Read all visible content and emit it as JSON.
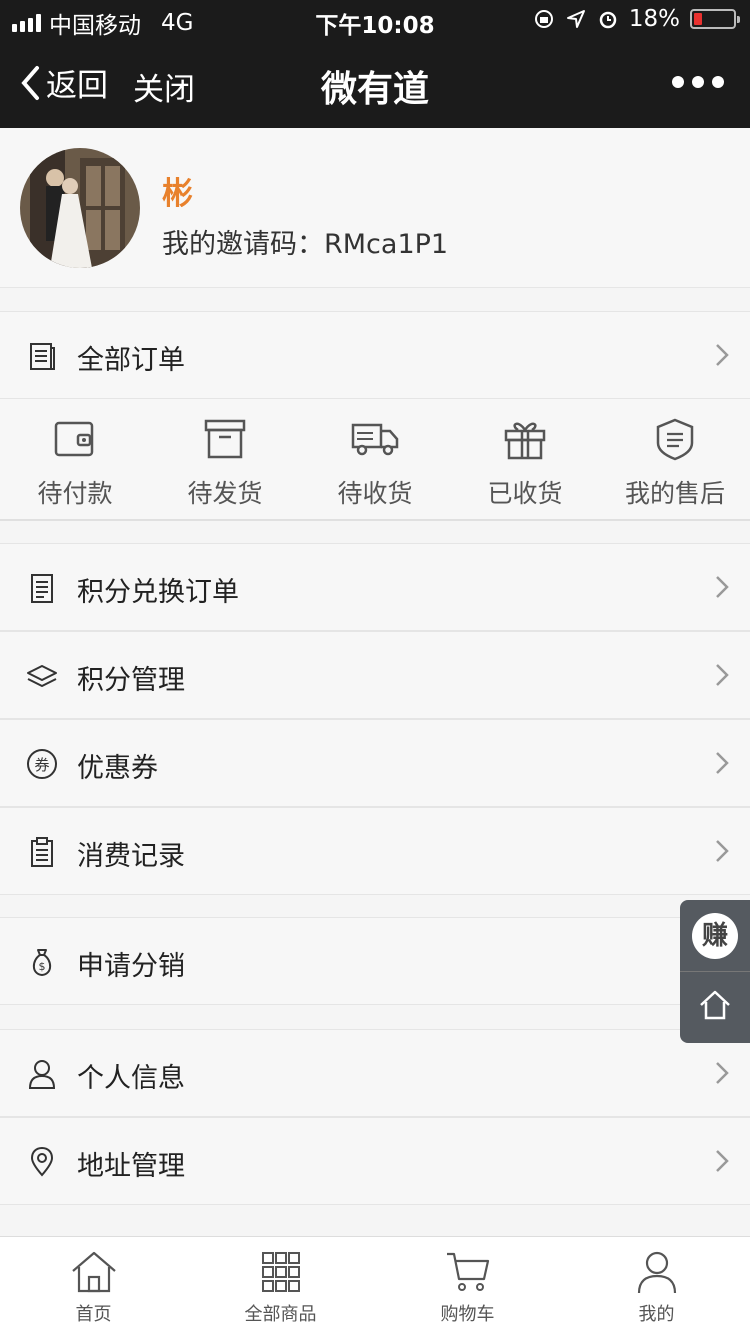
{
  "status_bar": {
    "carrier": "中国移动",
    "network": "4G",
    "time": "下午10:08",
    "battery": "18%"
  },
  "nav": {
    "back_label": "返回",
    "close_label": "关闭",
    "title": "微有道"
  },
  "profile": {
    "name": "彬",
    "invite_code": "我的邀请码：RMca1P1"
  },
  "orders": {
    "all_label": "全部订单",
    "statuses": [
      {
        "label": "待付款",
        "icon": "wallet-icon"
      },
      {
        "label": "待发货",
        "icon": "box-icon"
      },
      {
        "label": "待收货",
        "icon": "truck-icon"
      },
      {
        "label": "已收货",
        "icon": "gift-icon"
      },
      {
        "label": "我的售后",
        "icon": "shield-icon"
      }
    ]
  },
  "menu": {
    "points_orders": "积分兑换订单",
    "points_manage": "积分管理",
    "coupons": "优惠券",
    "consumption": "消费记录",
    "distribution": "申请分销",
    "personal_info": "个人信息",
    "address": "地址管理"
  },
  "float": {
    "earn_label": "赚"
  },
  "tabbar": {
    "home": "首页",
    "all_products": "全部商品",
    "cart": "购物车",
    "mine": "我的"
  }
}
